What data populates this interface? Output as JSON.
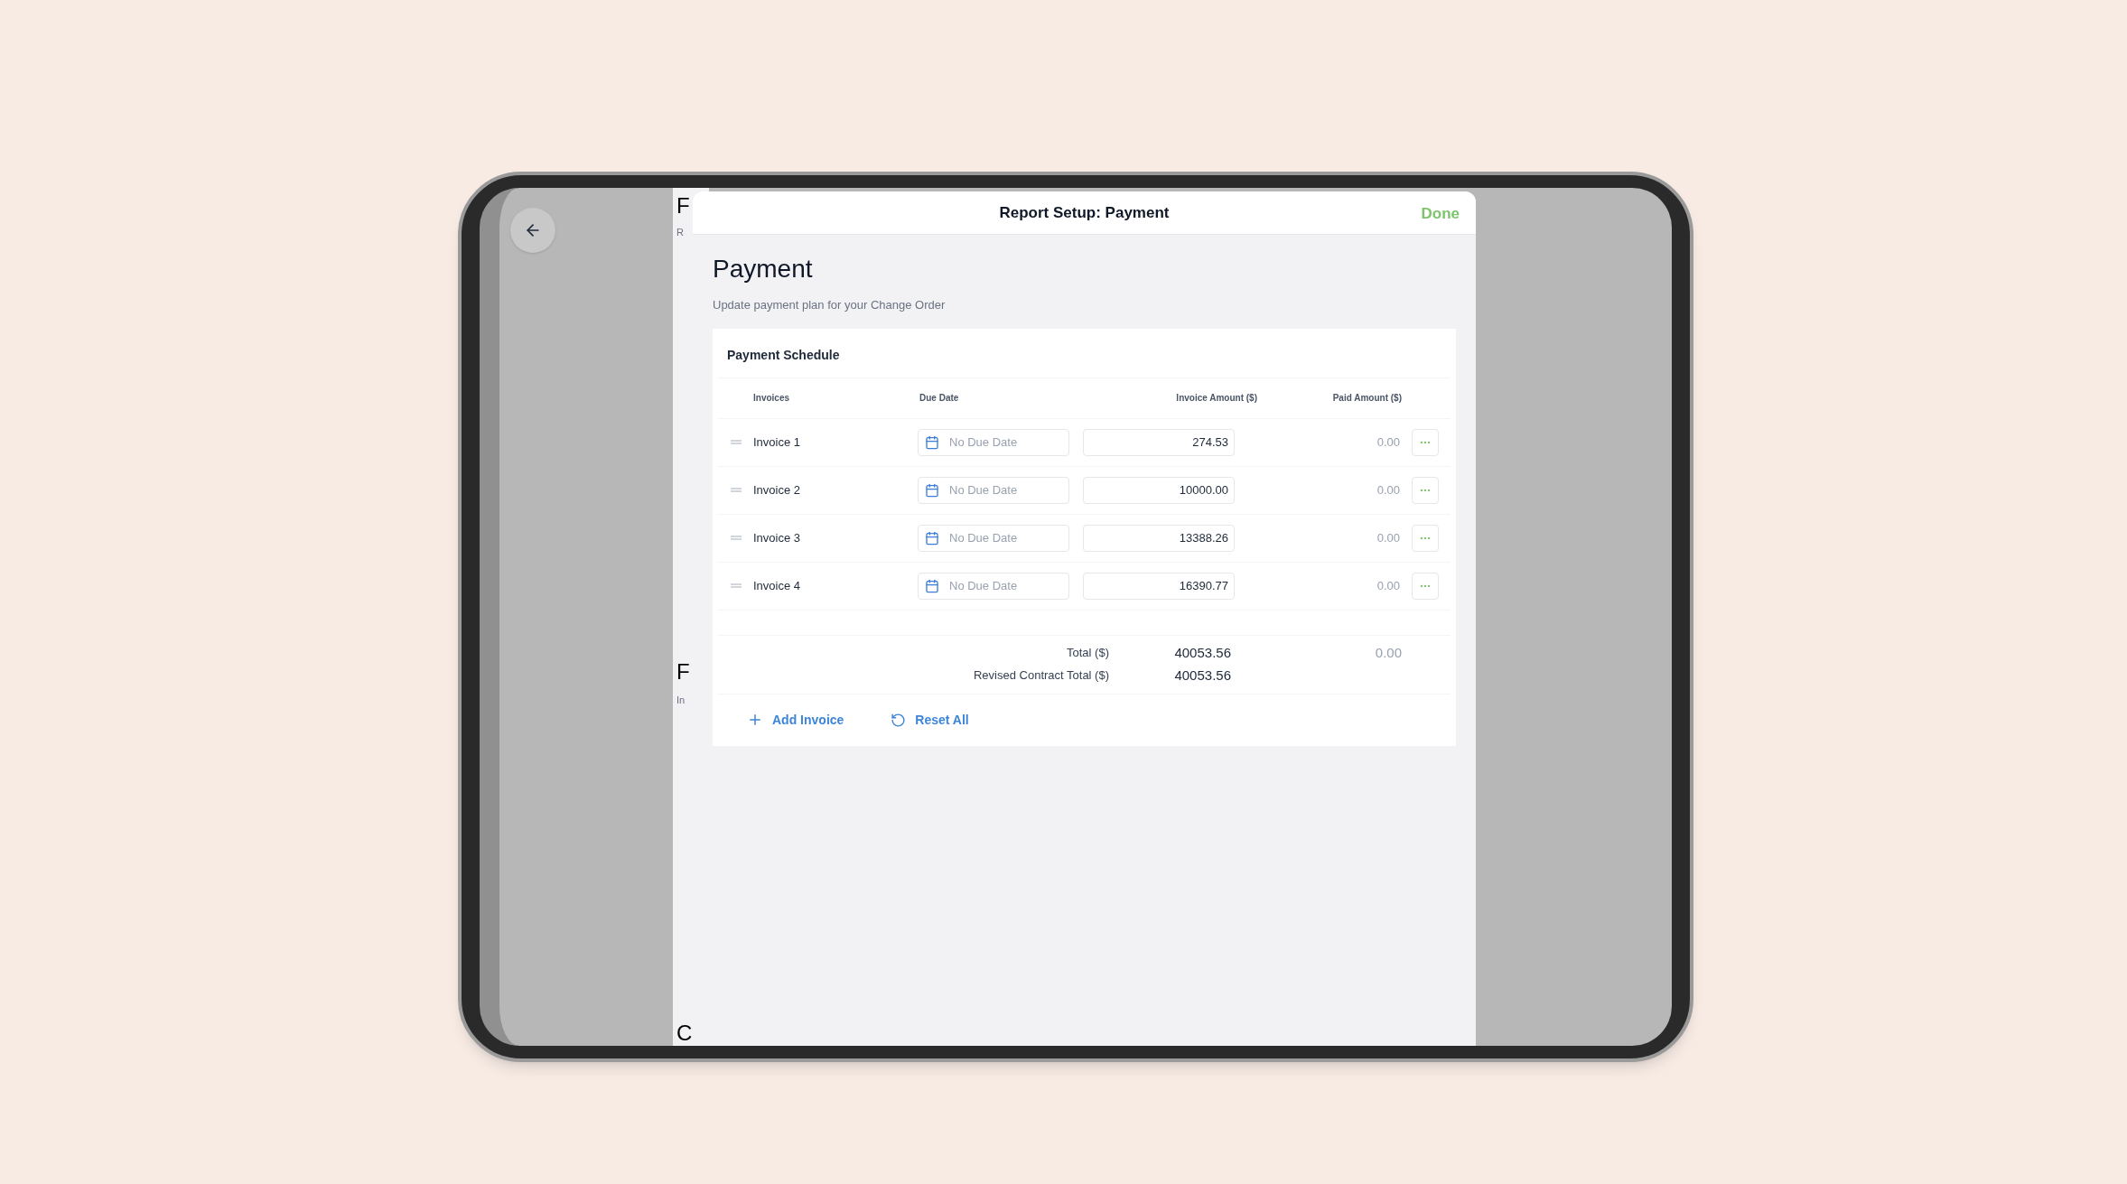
{
  "background_page": {
    "fragments": [
      "F",
      "R",
      "F",
      "In",
      "C"
    ]
  },
  "modal": {
    "title": "Report Setup: Payment",
    "done": "Done"
  },
  "page": {
    "title": "Payment",
    "subtitle": "Update payment plan for your Change Order"
  },
  "schedule": {
    "title": "Payment Schedule",
    "columns": [
      "Invoices",
      "Due Date",
      "Invoice Amount ($)",
      "Paid Amount ($)"
    ],
    "rows": [
      {
        "invoice": "Invoice 1",
        "placeholder": "No Due Date",
        "amount": "274.53",
        "paid": "0.00"
      },
      {
        "invoice": "Invoice 2",
        "placeholder": "No Due Date",
        "amount": "10000.00",
        "paid": "0.00"
      },
      {
        "invoice": "Invoice 3",
        "placeholder": "No Due Date",
        "amount": "13388.26",
        "paid": "0.00"
      },
      {
        "invoice": "Invoice 4",
        "placeholder": "No Due Date",
        "amount": "16390.77",
        "paid": "0.00"
      }
    ],
    "totals": [
      {
        "label": "Total ($)",
        "amount": "40053.56",
        "paid": "0.00"
      },
      {
        "label": "Revised Contract Total ($)",
        "amount": "40053.56"
      }
    ],
    "actions": [
      {
        "kind": "add",
        "label": "Add Invoice"
      },
      {
        "kind": "reset",
        "label": "Reset All"
      }
    ]
  }
}
